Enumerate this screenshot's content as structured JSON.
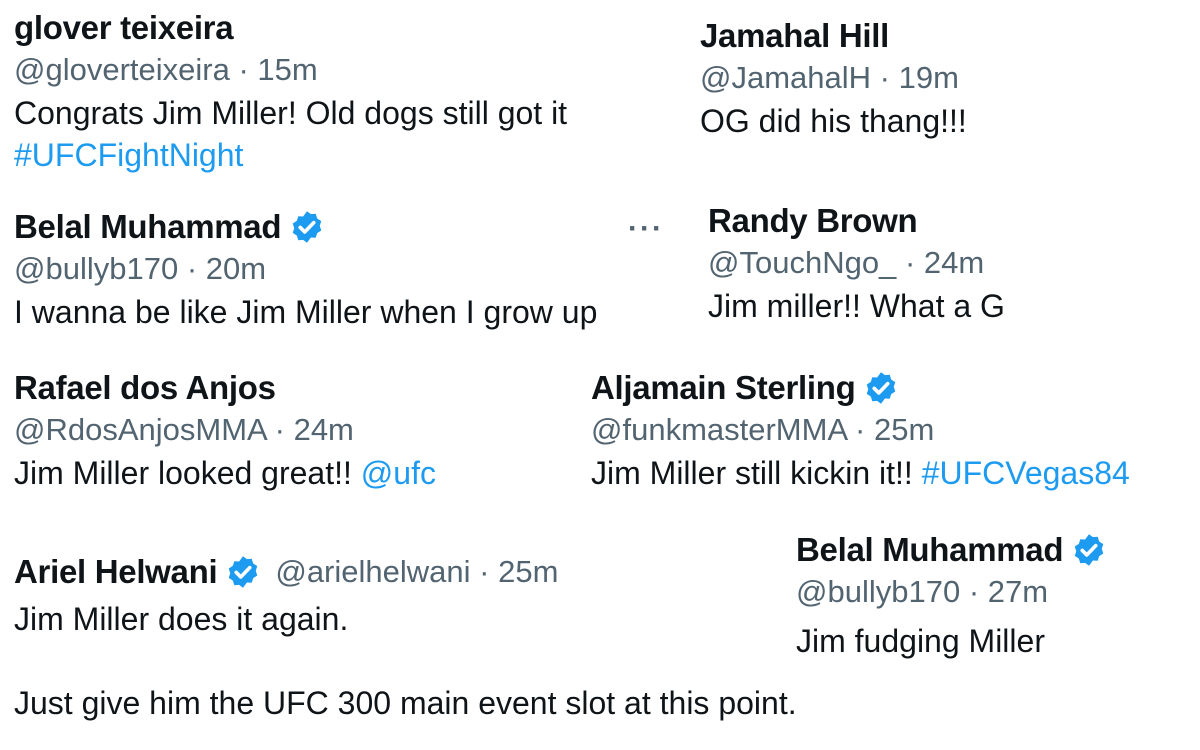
{
  "tweets": [
    {
      "name": "glover teixeira",
      "handle": "@gloverteixeira",
      "time": "15m",
      "text": "Congrats Jim Miller! Old dogs still got it",
      "link": "#UFCFightNight",
      "verified": false
    },
    {
      "name": "Jamahal Hill",
      "handle": "@JamahalH",
      "time": "19m",
      "text": "OG did his thang!!!",
      "verified": false
    },
    {
      "name": "Belal Muhammad",
      "handle": "@bullyb170",
      "time": "20m",
      "text": "I wanna be like Jim Miller when I grow up",
      "verified": true
    },
    {
      "name": "Randy Brown",
      "handle": "@TouchNgo_",
      "time": "24m",
      "text": "Jim miller!! What a G",
      "verified": false
    },
    {
      "name": "Rafael dos Anjos",
      "handle": "@RdosAnjosMMA",
      "time": "24m",
      "text": "Jim Miller looked great!!",
      "link": "@ufc",
      "verified": false
    },
    {
      "name": "Aljamain Sterling",
      "handle": "@funkmasterMMA",
      "time": "25m",
      "text": "Jim Miller still kickin it!!",
      "link": "#UFCVegas84",
      "verified": true
    },
    {
      "name": "Ariel Helwani",
      "handle": "@arielhelwani",
      "time": "25m",
      "text": "Jim Miller does it again.",
      "verified": true
    },
    {
      "name": "Belal Muhammad",
      "handle": "@bullyb170",
      "time": "27m",
      "text": "Jim fudging Miller",
      "verified": true
    }
  ],
  "separator": "·",
  "more_menu": "···",
  "footer_text": "Just give him the UFC 300 main event slot at this point.",
  "colors": {
    "text": "#0f1419",
    "muted": "#536471",
    "link": "#1d9bf0",
    "verified": "#1d9bf0"
  },
  "icons": {
    "verified": "verified-badge-icon",
    "more": "more-options-icon"
  }
}
